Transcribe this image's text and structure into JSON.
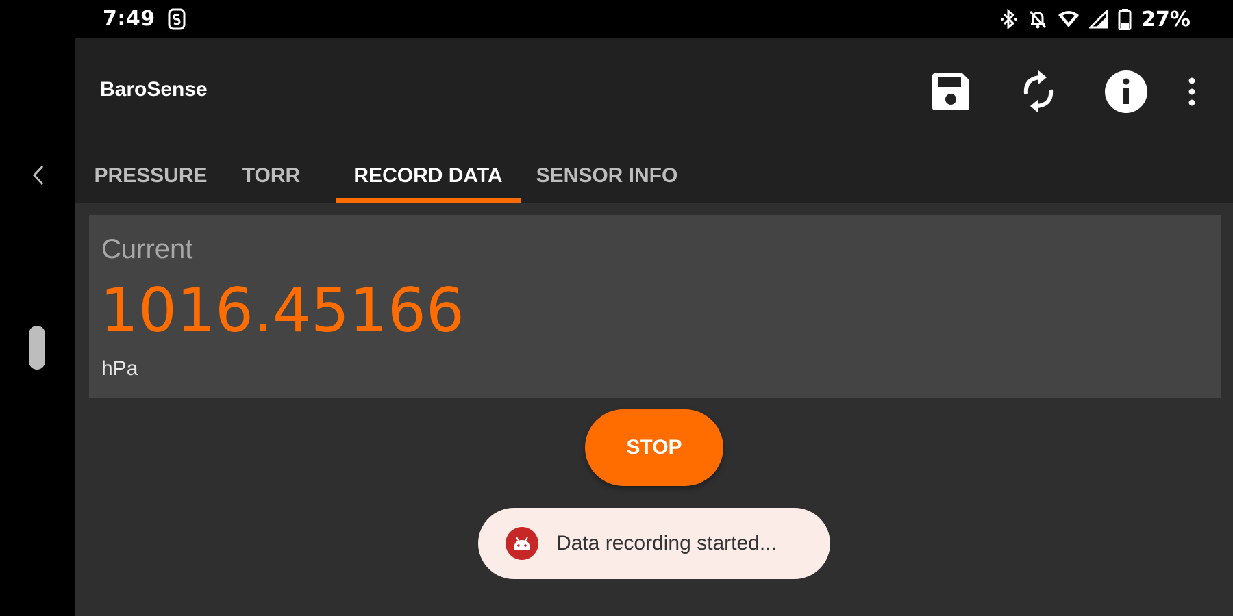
{
  "status_bar": {
    "time": "7:49",
    "battery": "27%",
    "icons": [
      "notification-s-icon",
      "bluetooth-icon",
      "mute-icon",
      "wifi-icon",
      "signal-icon",
      "battery-icon"
    ]
  },
  "app": {
    "title": "BaroSense",
    "actions": [
      "save-icon",
      "refresh-icon",
      "info-icon",
      "more-vert-icon"
    ]
  },
  "tabs": [
    {
      "label": "PRESSURE",
      "active": false
    },
    {
      "label": "TORR",
      "active": false
    },
    {
      "label": "RECORD DATA",
      "active": true
    },
    {
      "label": "SENSOR INFO",
      "active": false
    }
  ],
  "current": {
    "label": "Current",
    "value": "1016.45166",
    "unit": "hPa"
  },
  "stop_button": {
    "label": "STOP"
  },
  "toast": {
    "icon": "android-icon",
    "text": "Data recording started..."
  },
  "colors": {
    "accent": "#ff6d00",
    "app_bar": "#212121",
    "background": "#2f2f2f",
    "card": "#444444",
    "toast_bg": "#fbece7",
    "toast_icon": "#c62828"
  }
}
